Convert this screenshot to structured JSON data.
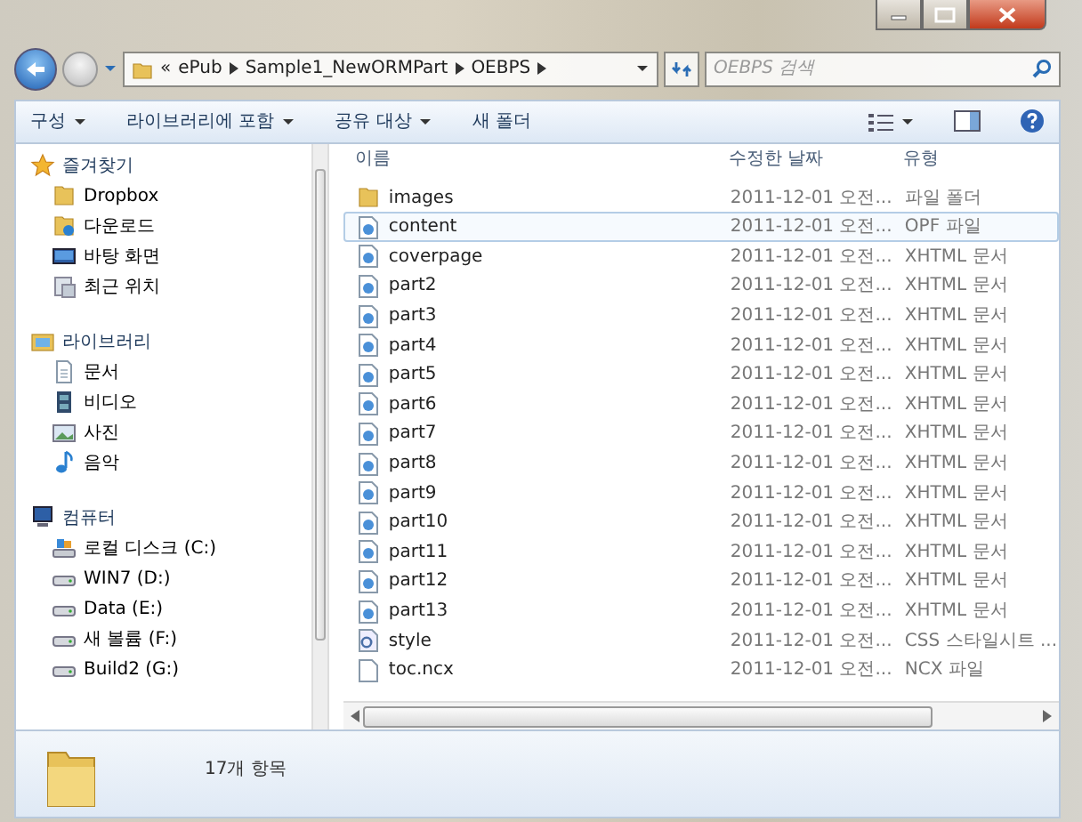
{
  "address": {
    "overflow": "«",
    "crumbs": [
      "ePub",
      "Sample1_NewORMPart",
      "OEBPS"
    ]
  },
  "search": {
    "placeholder": "OEBPS 검색"
  },
  "toolbar": [
    {
      "label": "구성",
      "dropdown": true
    },
    {
      "label": "라이브러리에 포함",
      "dropdown": true
    },
    {
      "label": "공유 대상",
      "dropdown": true
    },
    {
      "label": "새 폴더",
      "dropdown": false
    }
  ],
  "sidebar": [
    {
      "label": "즐겨찾기",
      "kind": "favorites",
      "children": [
        {
          "label": "Dropbox",
          "kind": "folder"
        },
        {
          "label": "다운로드",
          "kind": "download"
        },
        {
          "label": "바탕 화면",
          "kind": "desktop"
        },
        {
          "label": "최근 위치",
          "kind": "recent"
        }
      ]
    },
    {
      "label": "라이브러리",
      "kind": "library",
      "children": [
        {
          "label": "문서",
          "kind": "document"
        },
        {
          "label": "비디오",
          "kind": "video"
        },
        {
          "label": "사진",
          "kind": "photo"
        },
        {
          "label": "음악",
          "kind": "music"
        }
      ]
    },
    {
      "label": "컴퓨터",
      "kind": "computer",
      "children": [
        {
          "label": "로컬 디스크 (C:)",
          "kind": "sysdrive"
        },
        {
          "label": "WIN7 (D:)",
          "kind": "drive"
        },
        {
          "label": "Data (E:)",
          "kind": "drive"
        },
        {
          "label": "새 볼륨 (F:)",
          "kind": "drive"
        },
        {
          "label": "Build2 (G:)",
          "kind": "drive"
        }
      ]
    }
  ],
  "table": {
    "columns": [
      "이름",
      "수정한 날짜",
      "유형"
    ],
    "rows": [
      {
        "name": "images",
        "date": "2011-12-01 오전...",
        "type": "파일 폴더",
        "kind": "folder",
        "selected": false
      },
      {
        "name": "content",
        "date": "2011-12-01 오전...",
        "type": "OPF 파일",
        "kind": "web",
        "selected": true
      },
      {
        "name": "coverpage",
        "date": "2011-12-01 오전...",
        "type": "XHTML 문서",
        "kind": "web",
        "selected": false
      },
      {
        "name": "part2",
        "date": "2011-12-01 오전...",
        "type": "XHTML 문서",
        "kind": "web",
        "selected": false
      },
      {
        "name": "part3",
        "date": "2011-12-01 오전...",
        "type": "XHTML 문서",
        "kind": "web",
        "selected": false
      },
      {
        "name": "part4",
        "date": "2011-12-01 오전...",
        "type": "XHTML 문서",
        "kind": "web",
        "selected": false
      },
      {
        "name": "part5",
        "date": "2011-12-01 오전...",
        "type": "XHTML 문서",
        "kind": "web",
        "selected": false
      },
      {
        "name": "part6",
        "date": "2011-12-01 오전...",
        "type": "XHTML 문서",
        "kind": "web",
        "selected": false
      },
      {
        "name": "part7",
        "date": "2011-12-01 오전...",
        "type": "XHTML 문서",
        "kind": "web",
        "selected": false
      },
      {
        "name": "part8",
        "date": "2011-12-01 오전...",
        "type": "XHTML 문서",
        "kind": "web",
        "selected": false
      },
      {
        "name": "part9",
        "date": "2011-12-01 오전...",
        "type": "XHTML 문서",
        "kind": "web",
        "selected": false
      },
      {
        "name": "part10",
        "date": "2011-12-01 오전...",
        "type": "XHTML 문서",
        "kind": "web",
        "selected": false
      },
      {
        "name": "part11",
        "date": "2011-12-01 오전...",
        "type": "XHTML 문서",
        "kind": "web",
        "selected": false
      },
      {
        "name": "part12",
        "date": "2011-12-01 오전...",
        "type": "XHTML 문서",
        "kind": "web",
        "selected": false
      },
      {
        "name": "part13",
        "date": "2011-12-01 오전...",
        "type": "XHTML 문서",
        "kind": "web",
        "selected": false
      },
      {
        "name": "style",
        "date": "2011-12-01 오전...",
        "type": "CSS 스타일시트 ...",
        "kind": "css",
        "selected": false
      },
      {
        "name": "toc.ncx",
        "date": "2011-12-01 오전...",
        "type": "NCX 파일",
        "kind": "blank",
        "selected": false
      }
    ]
  },
  "status_bar": {
    "count": "17개 항목"
  }
}
